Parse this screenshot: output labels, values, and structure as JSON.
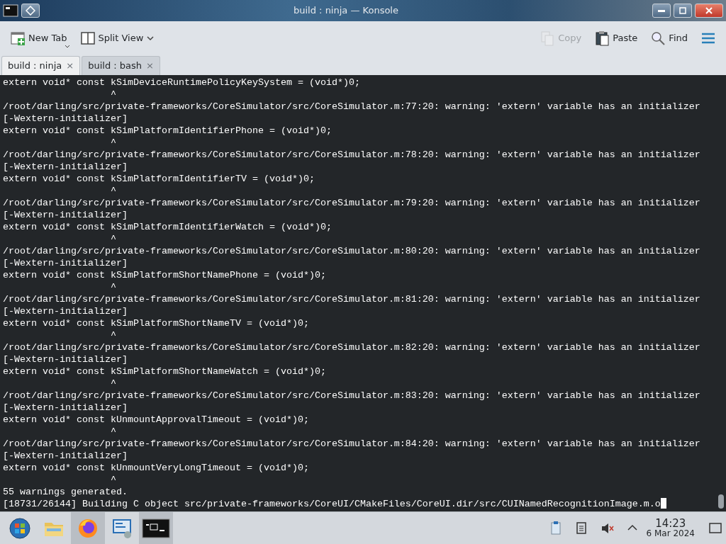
{
  "window": {
    "title": "build : ninja — Konsole"
  },
  "toolbar": [
    {
      "kind": "new-tab",
      "label": "New Tab",
      "disabled": false
    },
    {
      "kind": "split-view",
      "label": "Split View",
      "disabled": false
    },
    {
      "kind": "copy",
      "label": "Copy",
      "disabled": true
    },
    {
      "kind": "paste",
      "label": "Paste",
      "disabled": false
    },
    {
      "kind": "find",
      "label": "Find",
      "disabled": false
    },
    {
      "kind": "menu",
      "disabled": false
    }
  ],
  "tabs": [
    {
      "label": "build : ninja",
      "close": "×",
      "selected": true
    },
    {
      "label": "build : bash",
      "close": "×",
      "selected": false
    }
  ],
  "terminal": {
    "lines": [
      "extern void* const kSimDeviceRuntimePolicyKeySystem = (void*)0;",
      "                   ^",
      "/root/darling/src/private-frameworks/CoreSimulator/src/CoreSimulator.m:77:20: warning: 'extern' variable has an initializer",
      "[-Wextern-initializer]",
      "extern void* const kSimPlatformIdentifierPhone = (void*)0;",
      "                   ^",
      "/root/darling/src/private-frameworks/CoreSimulator/src/CoreSimulator.m:78:20: warning: 'extern' variable has an initializer",
      "[-Wextern-initializer]",
      "extern void* const kSimPlatformIdentifierTV = (void*)0;",
      "                   ^",
      "/root/darling/src/private-frameworks/CoreSimulator/src/CoreSimulator.m:79:20: warning: 'extern' variable has an initializer",
      "[-Wextern-initializer]",
      "extern void* const kSimPlatformIdentifierWatch = (void*)0;",
      "                   ^",
      "/root/darling/src/private-frameworks/CoreSimulator/src/CoreSimulator.m:80:20: warning: 'extern' variable has an initializer",
      "[-Wextern-initializer]",
      "extern void* const kSimPlatformShortNamePhone = (void*)0;",
      "                   ^",
      "/root/darling/src/private-frameworks/CoreSimulator/src/CoreSimulator.m:81:20: warning: 'extern' variable has an initializer",
      "[-Wextern-initializer]",
      "extern void* const kSimPlatformShortNameTV = (void*)0;",
      "                   ^",
      "/root/darling/src/private-frameworks/CoreSimulator/src/CoreSimulator.m:82:20: warning: 'extern' variable has an initializer",
      "[-Wextern-initializer]",
      "extern void* const kSimPlatformShortNameWatch = (void*)0;",
      "                   ^",
      "/root/darling/src/private-frameworks/CoreSimulator/src/CoreSimulator.m:83:20: warning: 'extern' variable has an initializer",
      "[-Wextern-initializer]",
      "extern void* const kUnmountApprovalTimeout = (void*)0;",
      "                   ^",
      "/root/darling/src/private-frameworks/CoreSimulator/src/CoreSimulator.m:84:20: warning: 'extern' variable has an initializer",
      "[-Wextern-initializer]",
      "extern void* const kUnmountVeryLongTimeout = (void*)0;",
      "                   ^",
      "55 warnings generated.",
      "[18731/26144] Building C object src/private-frameworks/CoreUI/CMakeFiles/CoreUI.dir/src/CUINamedRecognitionImage.m.o"
    ]
  },
  "taskbar": {
    "apps": [
      {
        "kind": "start",
        "highlighted": false
      },
      {
        "kind": "folder",
        "highlighted": false
      },
      {
        "kind": "browser",
        "highlighted": true
      },
      {
        "kind": "settings",
        "highlighted": false
      },
      {
        "kind": "terminal",
        "highlighted": true
      }
    ],
    "tray": [
      {
        "kind": "clipboard"
      },
      {
        "kind": "notes"
      },
      {
        "kind": "muted"
      },
      {
        "kind": "expand"
      }
    ],
    "clock": {
      "time": "14:23",
      "date": "6 Mar 2024"
    }
  }
}
